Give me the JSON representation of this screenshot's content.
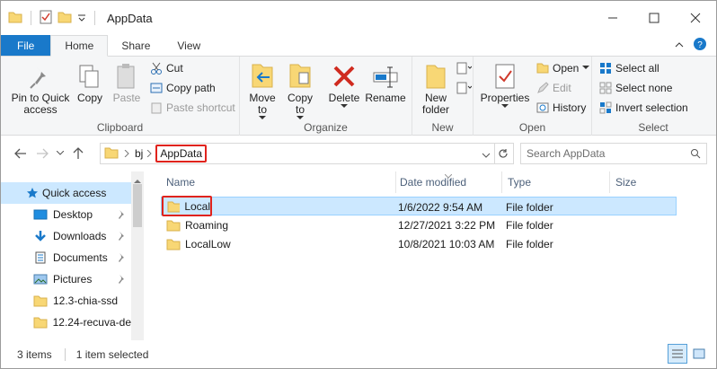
{
  "window": {
    "title": "AppData"
  },
  "tabs": {
    "file": "File",
    "home": "Home",
    "share": "Share",
    "view": "View"
  },
  "ribbon": {
    "clipboard": {
      "label": "Clipboard",
      "pin": "Pin to Quick access",
      "copy": "Copy",
      "paste": "Paste",
      "cut": "Cut",
      "copy_path": "Copy path",
      "paste_shortcut": "Paste shortcut"
    },
    "organize": {
      "label": "Organize",
      "move_to": "Move to",
      "copy_to": "Copy to",
      "delete": "Delete",
      "rename": "Rename"
    },
    "new": {
      "label": "New",
      "new_folder": "New folder"
    },
    "open": {
      "label": "Open",
      "properties": "Properties",
      "open": "Open",
      "edit": "Edit",
      "history": "History"
    },
    "select": {
      "label": "Select",
      "select_all": "Select all",
      "select_none": "Select none",
      "invert_selection": "Invert selection"
    }
  },
  "address": {
    "breadcrumbs": [
      "bj",
      "AppData"
    ],
    "search_placeholder": "Search AppData"
  },
  "nav": {
    "items": [
      {
        "label": "Quick access",
        "pinned": false,
        "icon": "star-icon"
      },
      {
        "label": "Desktop",
        "pinned": true,
        "icon": "desktop-icon"
      },
      {
        "label": "Downloads",
        "pinned": true,
        "icon": "download-icon"
      },
      {
        "label": "Documents",
        "pinned": true,
        "icon": "documents-icon"
      },
      {
        "label": "Pictures",
        "pinned": true,
        "icon": "pictures-icon"
      },
      {
        "label": "12.3-chia-ssd",
        "pinned": false,
        "icon": "folder-icon"
      },
      {
        "label": "12.24-recuva-de",
        "pinned": false,
        "icon": "folder-icon"
      }
    ]
  },
  "columns": {
    "name": "Name",
    "date_modified": "Date modified",
    "type": "Type",
    "size": "Size"
  },
  "files": [
    {
      "name": "Local",
      "date": "1/6/2022 9:54 AM",
      "type": "File folder",
      "size": ""
    },
    {
      "name": "Roaming",
      "date": "12/27/2021 3:22 PM",
      "type": "File folder",
      "size": ""
    },
    {
      "name": "LocalLow",
      "date": "10/8/2021 10:03 AM",
      "type": "File folder",
      "size": ""
    }
  ],
  "status": {
    "items": "3 items",
    "selected": "1 item selected"
  },
  "colors": {
    "accent": "#1979ca",
    "selection": "#cce8ff",
    "highlight": "#e0231c",
    "folder": "#f8d775"
  }
}
